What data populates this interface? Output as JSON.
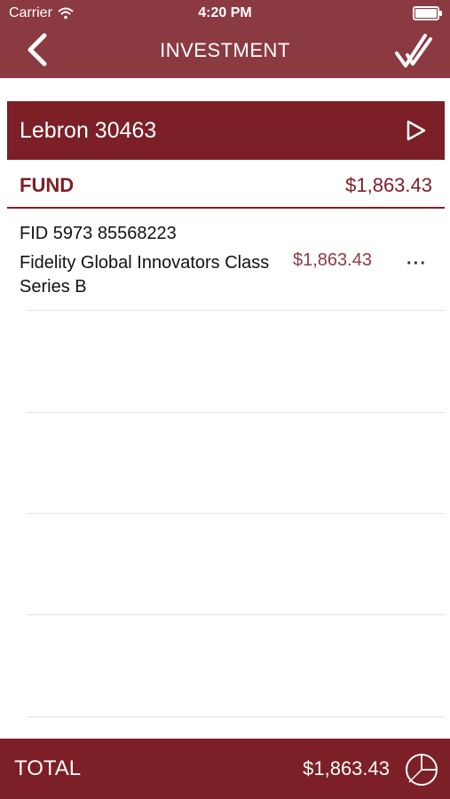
{
  "status_bar": {
    "carrier": "Carrier",
    "time": "4:20 PM"
  },
  "nav": {
    "title": "INVESTMENT",
    "back_icon": "chevron-left-icon",
    "confirm_icon": "double-check-icon"
  },
  "account": {
    "name": "Lebron 30463",
    "action_icon": "play-triangle-icon"
  },
  "fund_section": {
    "label": "FUND",
    "total": "$1,863.43"
  },
  "funds": [
    {
      "id": "FID 5973 85568223",
      "name": "Fidelity Global Innovators Class Series B",
      "amount": "$1,863.43",
      "more": "···"
    }
  ],
  "footer": {
    "label": "TOTAL",
    "value": "$1,863.43",
    "icon": "pie-chart-icon"
  },
  "colors": {
    "header": "#8b3a42",
    "accent": "#7c1f27"
  }
}
